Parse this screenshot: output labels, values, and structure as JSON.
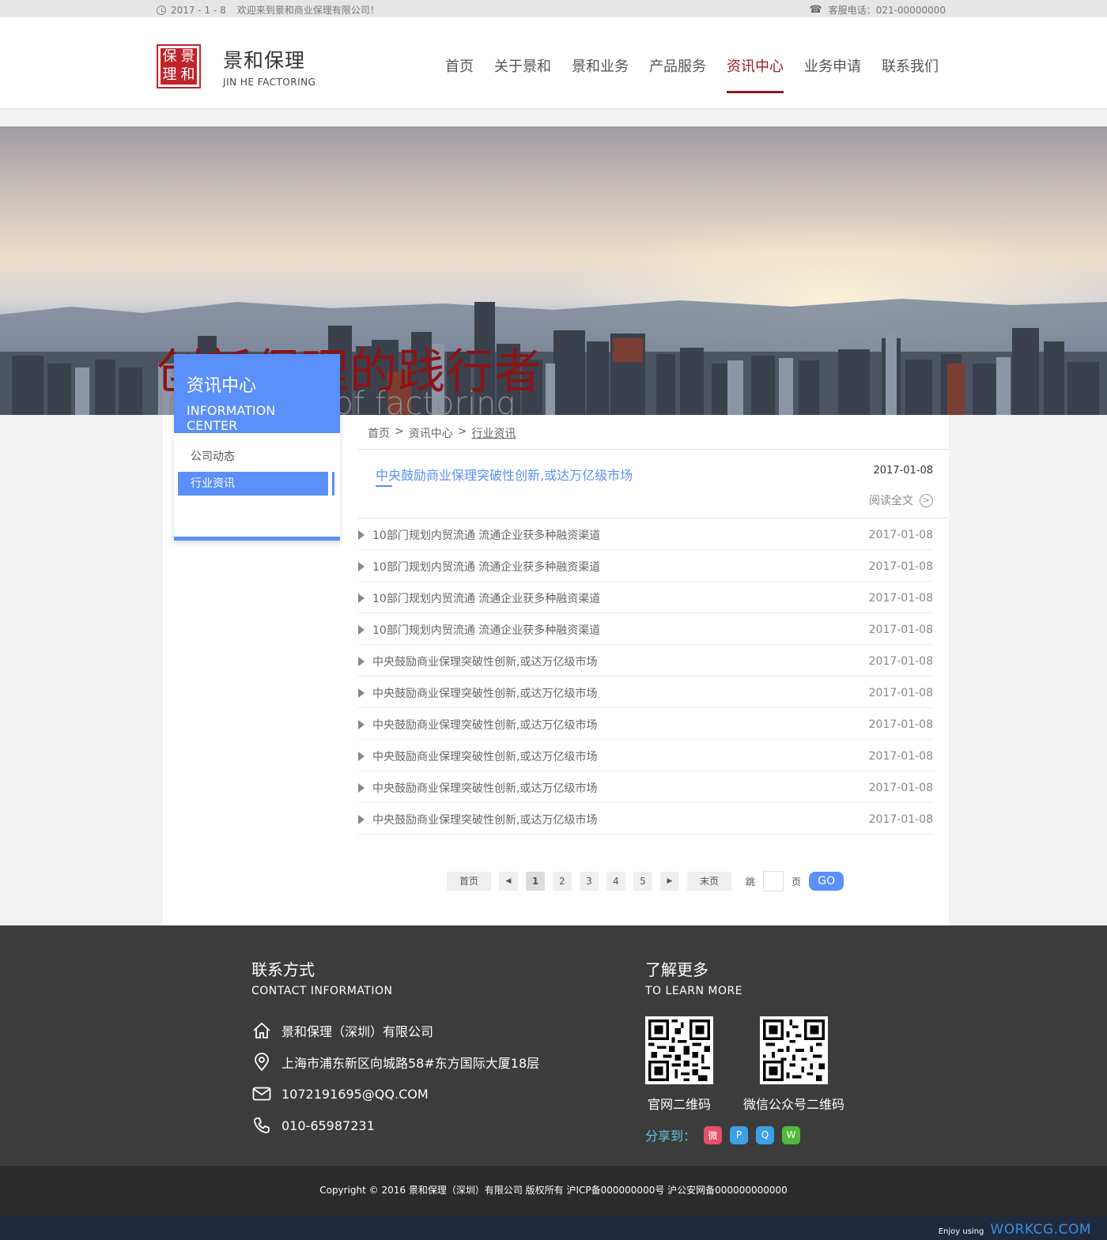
{
  "topbar": {
    "date": "2017 - 1 - 8",
    "welcome": "欢迎来到景和商业保理有限公司！",
    "hotline": "客服电话：021-00000000"
  },
  "header": {
    "seal_chars": [
      "保",
      "景",
      "理",
      "和"
    ],
    "brand_cn": "景和保理",
    "brand_en": "JIN HE FACTORING",
    "nav": [
      {
        "label": "首页",
        "active": false
      },
      {
        "label": "关于景和",
        "active": false
      },
      {
        "label": "景和业务",
        "active": false
      },
      {
        "label": "产品服务",
        "active": false
      },
      {
        "label": "资讯中心",
        "active": true
      },
      {
        "label": "业务申请",
        "active": false
      },
      {
        "label": "联系我们",
        "active": false
      }
    ]
  },
  "banner": {
    "title_cn": "创新保理的践行者",
    "title_en": "Innovation of factoring"
  },
  "sidebar": {
    "title": "资讯中心",
    "subtitle": "INFORMATION CENTER",
    "items": [
      {
        "label": "公司动态",
        "active": false
      },
      {
        "label": "行业资讯",
        "active": true
      }
    ]
  },
  "breadcrumb": {
    "home": "首页",
    "sep": ">",
    "section": "资讯中心",
    "current": "行业资讯"
  },
  "featured": {
    "title": "中央鼓励商业保理突破性创新,或达万亿级市场",
    "date": "2017-01-08",
    "read_more": "阅读全文"
  },
  "news": [
    {
      "title": "10部门规划内贸流通 流通企业获多种融资渠道",
      "date": "2017-01-08"
    },
    {
      "title": "10部门规划内贸流通 流通企业获多种融资渠道",
      "date": "2017-01-08"
    },
    {
      "title": "10部门规划内贸流通 流通企业获多种融资渠道",
      "date": "2017-01-08"
    },
    {
      "title": "10部门规划内贸流通 流通企业获多种融资渠道",
      "date": "2017-01-08"
    },
    {
      "title": "中央鼓励商业保理突破性创新,或达万亿级市场",
      "date": "2017-01-08"
    },
    {
      "title": "中央鼓励商业保理突破性创新,或达万亿级市场",
      "date": "2017-01-08"
    },
    {
      "title": "中央鼓励商业保理突破性创新,或达万亿级市场",
      "date": "2017-01-08"
    },
    {
      "title": "中央鼓励商业保理突破性创新,或达万亿级市场",
      "date": "2017-01-08"
    },
    {
      "title": "中央鼓励商业保理突破性创新,或达万亿级市场",
      "date": "2017-01-08"
    },
    {
      "title": "中央鼓励商业保理突破性创新,或达万亿级市场",
      "date": "2017-01-08"
    }
  ],
  "pager": {
    "first": "首页",
    "last": "末页",
    "pages": [
      "1",
      "2",
      "3",
      "4",
      "5"
    ],
    "current": "1",
    "jump_prefix": "跳",
    "jump_suffix": "页",
    "go": "GO"
  },
  "footer": {
    "contact_title": "联系方式",
    "contact_sub": "CONTACT INFORMATION",
    "company": "景和保理（深圳）有限公司",
    "address": "上海市浦东新区向城路58#东方国际大厦18层",
    "email": "1072191695@QQ.COM",
    "phone": "010-65987231",
    "learn_title": "了解更多",
    "learn_sub": "TO LEARN MORE",
    "qr1_label": "官网二维码",
    "qr2_label": "微信公众号二维码",
    "share_label": "分享到：",
    "copyright": "Copyright © 2016   景和保理（深圳）有限公司   版权所有   沪ICP备000000000号   沪公安网备000000000000"
  },
  "watermark": {
    "prefix": "Enjoy using",
    "brand": "WORKCG.COM"
  },
  "colors": {
    "accent_blue": "#5b8ff9",
    "brand_red": "#8a1417",
    "footer_bg": "#3c3c3c"
  }
}
